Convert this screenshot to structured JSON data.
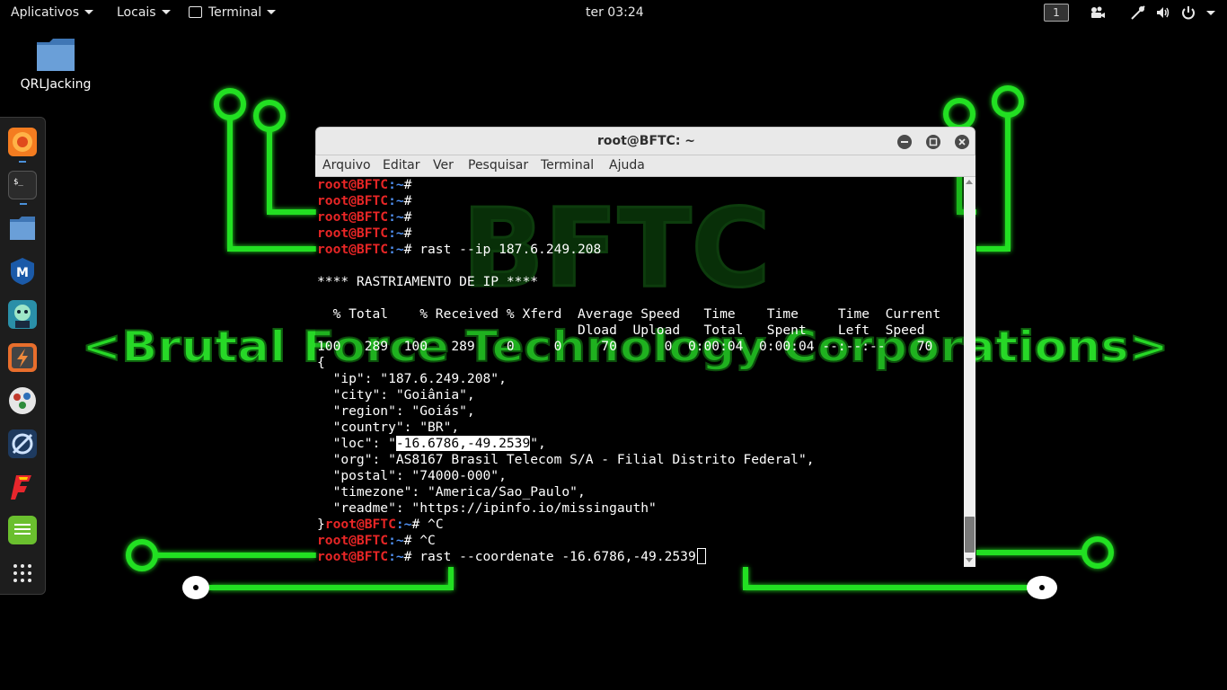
{
  "topbar": {
    "applications": "Aplicativos",
    "places": "Locais",
    "terminal": "Terminal",
    "clock": "ter 03:24",
    "workspace": "1"
  },
  "desktop": {
    "icon_label": "QRLJacking",
    "wallpaper_title": "BFTC",
    "wallpaper_subtitle": "<Brutal Force Technology Corporations>"
  },
  "dock": {
    "items": [
      "firefox-icon",
      "terminal-icon",
      "files-icon",
      "metasploit-icon",
      "armitage-icon",
      "burpsuite-icon",
      "maltego-icon",
      "faraday-icon",
      "fern-icon",
      "notes-icon",
      "app-grid-icon"
    ]
  },
  "window": {
    "title": "root@BFTC: ~",
    "menu": [
      "Arquivo",
      "Editar",
      "Ver",
      "Pesquisar",
      "Terminal",
      "Ajuda"
    ]
  },
  "terminal": {
    "user_host": "root@BFTC",
    "path": ":~",
    "prompt_suffix": "# ",
    "cmd1": "rast --ip 187.6.249.208",
    "banner": "**** RASTRIAMENTO DE IP ****",
    "curl_header1": "  % Total    % Received % Xferd  Average Speed   Time    Time     Time  Current",
    "curl_header2": "                                 Dload  Upload   Total   Spent    Left  Speed",
    "curl_progress": "100   289  100   289    0     0     70      0  0:00:04  0:00:04 --:--:--    70",
    "json_open": "{",
    "ip": "  \"ip\": \"187.6.249.208\",",
    "city": "  \"city\": \"Goiânia\",",
    "region": "  \"region\": \"Goiás\",",
    "country": "  \"country\": \"BR\",",
    "loc_pre": "  \"loc\": \"",
    "loc_value": "-16.6786,-49.2539",
    "loc_post": "\",",
    "org": "  \"org\": \"AS8167 Brasil Telecom S/A - Filial Distrito Federal\",",
    "postal": "  \"postal\": \"74000-000\",",
    "timezone": "  \"timezone\": \"America/Sao_Paulo\",",
    "readme": "  \"readme\": \"https://ipinfo.io/missingauth\"",
    "json_close": "}",
    "ctrl_c": "^C",
    "cmd2": "rast --coordenate -16.6786,-49.2539"
  }
}
